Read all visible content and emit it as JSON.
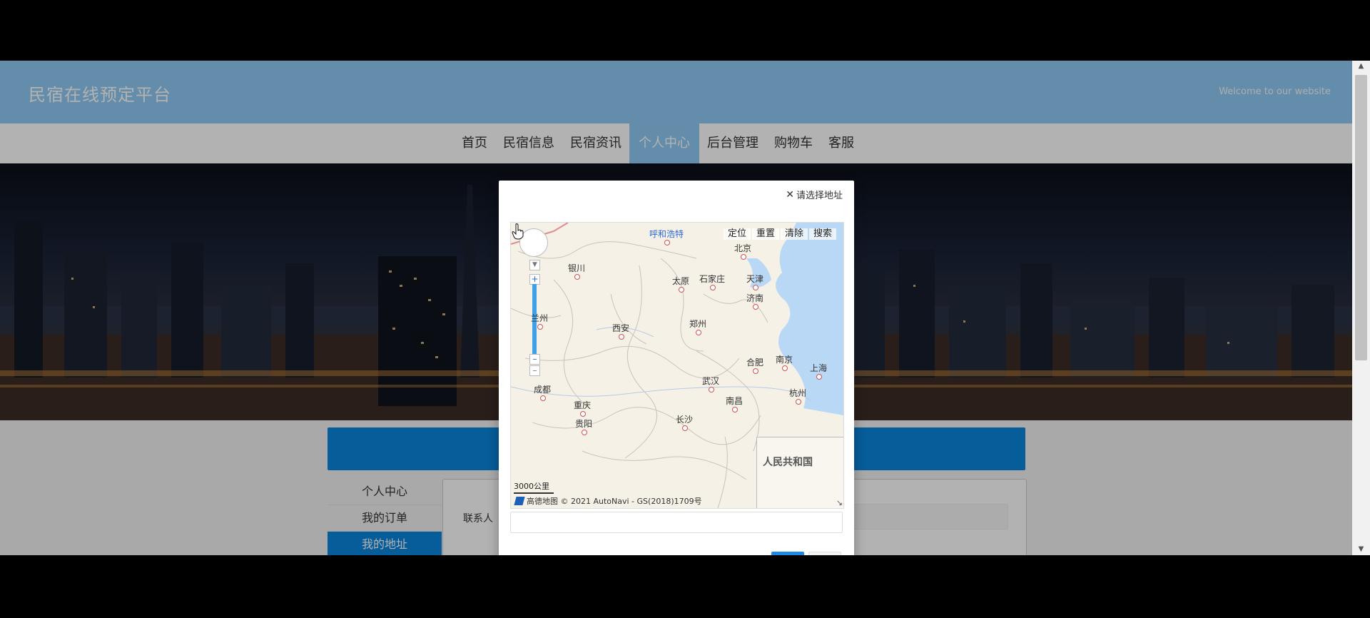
{
  "header": {
    "site_title": "民宿在线预定平台",
    "welcome": "Welcome to our website"
  },
  "nav": {
    "items": [
      {
        "label": "首页"
      },
      {
        "label": "民宿信息"
      },
      {
        "label": "民宿资讯"
      },
      {
        "label": "个人中心",
        "active": true
      },
      {
        "label": "后台管理"
      },
      {
        "label": "购物车"
      },
      {
        "label": "客服"
      }
    ]
  },
  "sidebar": {
    "items": [
      {
        "label": "个人中心"
      },
      {
        "label": "我的订单"
      },
      {
        "label": "我的地址",
        "active": true
      }
    ]
  },
  "form": {
    "contact_label": "联系人"
  },
  "modal": {
    "close_label": "请选择地址",
    "map": {
      "toolbar": [
        "定位",
        "重置",
        "清除",
        "搜索"
      ],
      "cities": [
        {
          "name": "呼和浩特",
          "link": true
        },
        {
          "name": "北京"
        },
        {
          "name": "银川"
        },
        {
          "name": "太原"
        },
        {
          "name": "石家庄"
        },
        {
          "name": "天津"
        },
        {
          "name": "济南"
        },
        {
          "name": "兰州"
        },
        {
          "name": "西安"
        },
        {
          "name": "郑州"
        },
        {
          "name": "合肥"
        },
        {
          "name": "南京"
        },
        {
          "name": "上海"
        },
        {
          "name": "武汉"
        },
        {
          "name": "成都"
        },
        {
          "name": "重庆"
        },
        {
          "name": "杭州"
        },
        {
          "name": "南昌"
        },
        {
          "name": "贵阳"
        },
        {
          "name": "长沙"
        }
      ],
      "scale": "3000公里",
      "copyright": "高德地图 © 2021 AutoNavi - GS(2018)1709号",
      "inset_label": "人民共和国"
    }
  },
  "colors": {
    "header_bg": "#8ecaf4",
    "accent": "#0a86dc",
    "nav_active": "#8ecaf4"
  }
}
